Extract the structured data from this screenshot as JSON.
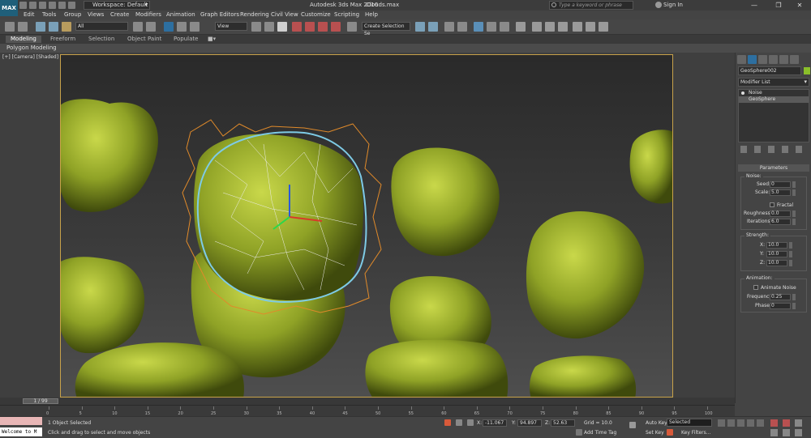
{
  "titlebar": {
    "logo": "MAX",
    "workspace": "Workspace: Default",
    "title": "Autodesk 3ds Max 2016",
    "file": "Clouds.max",
    "search_placeholder": "Type a keyword or phrase",
    "sign_in": "Sign In"
  },
  "menu": [
    "Edit",
    "Tools",
    "Group",
    "Views",
    "Create",
    "Modifiers",
    "Animation",
    "Graph Editors",
    "Rendering",
    "Civil View",
    "Customize",
    "Scripting",
    "Help"
  ],
  "toolbar": {
    "selection_filter": "All",
    "ref_coord": "View",
    "named_selection": "Create Selection Se"
  },
  "ribbon": {
    "tabs": [
      "Modeling",
      "Freeform",
      "Selection",
      "Object Paint",
      "Populate"
    ],
    "sub": "Polygon Modeling"
  },
  "viewport": {
    "label": "[+] [Camera] [Shaded]"
  },
  "command_panel": {
    "object_name": "GeoSphere002",
    "modifier_list": "Modifier List",
    "stack": [
      "Noise",
      "GeoSphere"
    ],
    "rollout": "Parameters",
    "noise_group": "Noise:",
    "seed_label": "Seed:",
    "seed": "0",
    "scale_label": "Scale:",
    "scale": "5.0",
    "fractal": "Fractal",
    "roughness_label": "Roughness:",
    "roughness": "0.0",
    "iterations_label": "Iterations:",
    "iterations": "6.0",
    "strength_group": "Strength:",
    "x_label": "X:",
    "x": "10.0",
    "y_label": "Y:",
    "y": "10.0",
    "z_label": "Z:",
    "z": "10.0",
    "animation_group": "Animation:",
    "animate_noise": "Animate Noise",
    "frequency_label": "Frequency:",
    "frequency": "0.25",
    "phase_label": "Phase:",
    "phase": "0"
  },
  "timeline": {
    "frame": "1 / 99",
    "ticks": [
      "0",
      "5",
      "10",
      "15",
      "20",
      "25",
      "30",
      "35",
      "40",
      "45",
      "50",
      "55",
      "60",
      "65",
      "70",
      "75",
      "80",
      "85",
      "90",
      "95",
      "100"
    ]
  },
  "status": {
    "maxscript": "Welcome to M",
    "selected": "1 Object Selected",
    "prompt": "Click and drag to select and move objects",
    "x_label": "X:",
    "x": "-11.067",
    "y_label": "Y:",
    "y": "94.897",
    "z_label": "Z:",
    "z": "52.63",
    "grid": "Grid = 10.0",
    "add_time_tag": "Add Time Tag",
    "auto_key": "Auto Key",
    "auto_key_sel": "Selected",
    "set_key": "Set Key",
    "key_filters": "Key Filters..."
  }
}
